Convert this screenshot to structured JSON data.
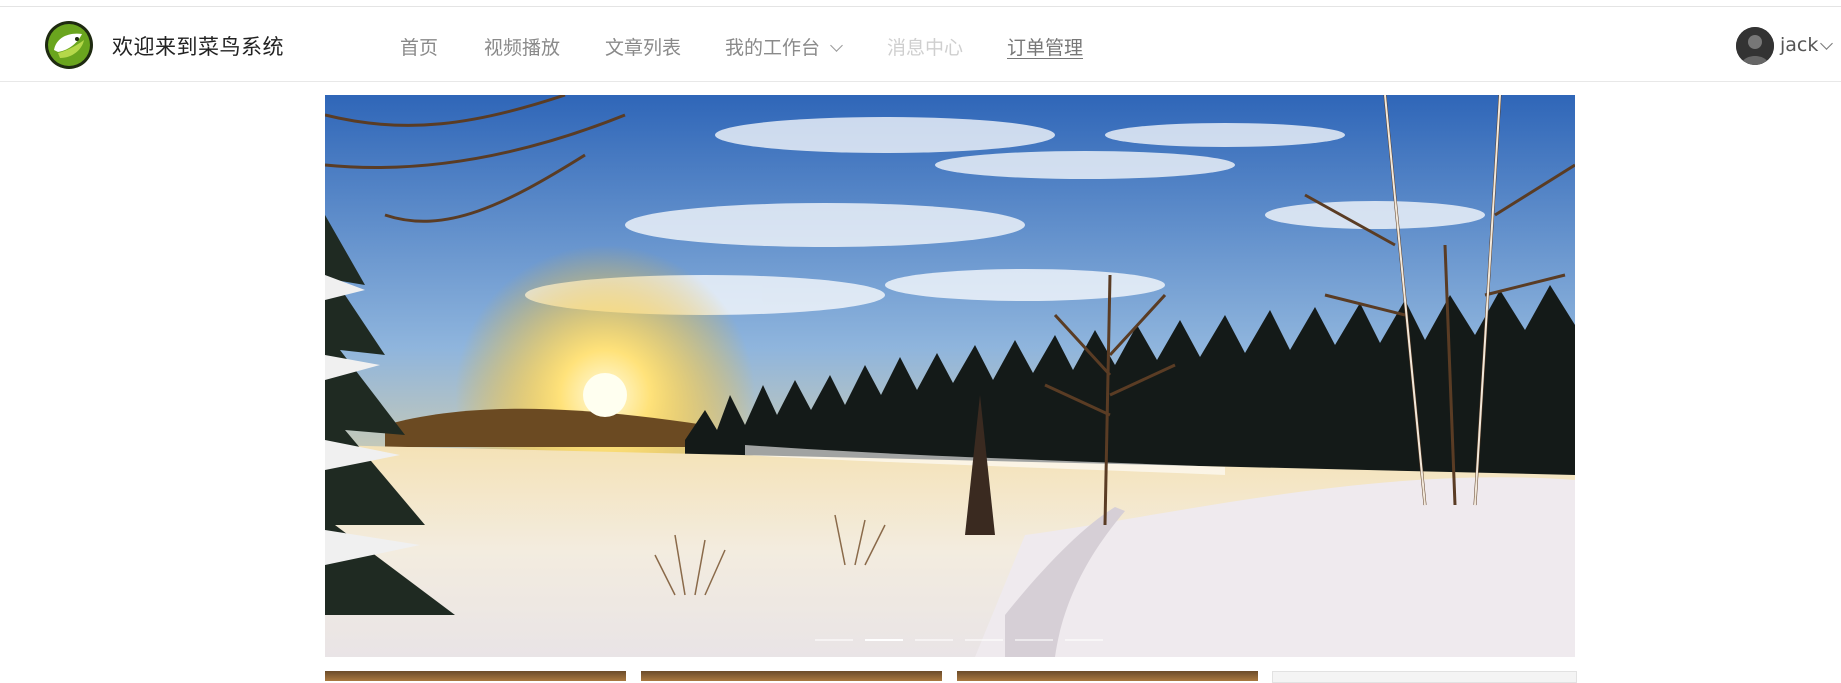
{
  "header": {
    "site_title": "欢迎来到菜鸟系统",
    "logo_icon": "leaf-logo-icon",
    "nav": {
      "home": "首页",
      "video": "视频播放",
      "articles": "文章列表",
      "workbench": "我的工作台",
      "messages": "消息中心",
      "orders": "订单管理"
    },
    "user": {
      "name": "jack",
      "avatar_icon": "user-avatar-icon"
    }
  },
  "carousel": {
    "slide_count": 6,
    "active_index": 1,
    "image": "snowy-winter-sunset-landscape"
  },
  "thumbnails": {
    "count": 4
  },
  "colors": {
    "nav_text": "#8a8a8a",
    "nav_disabled": "#cfcfcf",
    "logo_green": "#6aa51e"
  }
}
